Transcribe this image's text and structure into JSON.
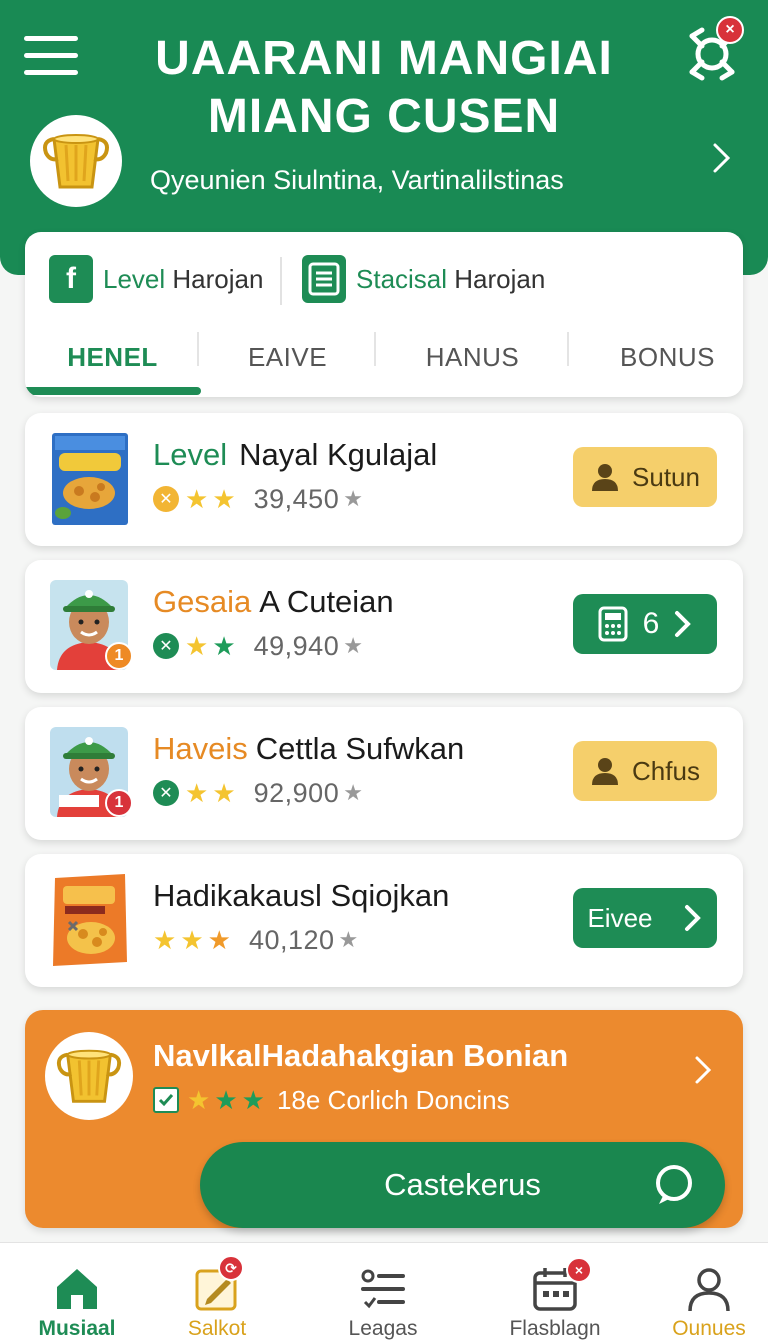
{
  "header": {
    "title_line1": "UAARANI MANGIAI",
    "title_line2": "MIANG CUSEN",
    "subtitle": "Qyeunien Siulntina, Vartinalilstinas",
    "notif_count": "×"
  },
  "filters": {
    "chip1_green": "Level",
    "chip1_dark": "Harojan",
    "chip2_green": "Stacisal",
    "chip2_dark": "Harojan",
    "chip1_icon_letter": "f"
  },
  "tabs": [
    "HENEL",
    "EAIVE",
    "HANUS",
    "BONUS"
  ],
  "items": [
    {
      "prefix": "Level",
      "name": "Nayal Kgulajal",
      "count": "39,450",
      "action": "Sutun"
    },
    {
      "prefix": "Gesaia",
      "name": "A Cuteian",
      "count": "49,940",
      "action": "6",
      "badge": "1"
    },
    {
      "prefix": "Haveis",
      "name": "Cettla Sufwkan",
      "count": "92,900",
      "action": "Chfus",
      "badge": "1"
    },
    {
      "prefix": "",
      "name": "Hadikakausl Sqiojkan",
      "count": "40,120",
      "action": "Eivee"
    }
  ],
  "promo": {
    "title": "NavlkalHadahakgian Bonian",
    "rating_text": "18e  Corlich Doncins",
    "button": "Castekerus"
  },
  "nav": [
    {
      "label": "Musiaal"
    },
    {
      "label": "Salkot"
    },
    {
      "label": "Leagas"
    },
    {
      "label": "Flasblagn"
    },
    {
      "label": "Ounues"
    }
  ],
  "colors": {
    "brand": "#198a54",
    "accent_orange": "#ec8a2e",
    "accent_yellow": "#f5cf6b",
    "alert": "#d8323a"
  }
}
